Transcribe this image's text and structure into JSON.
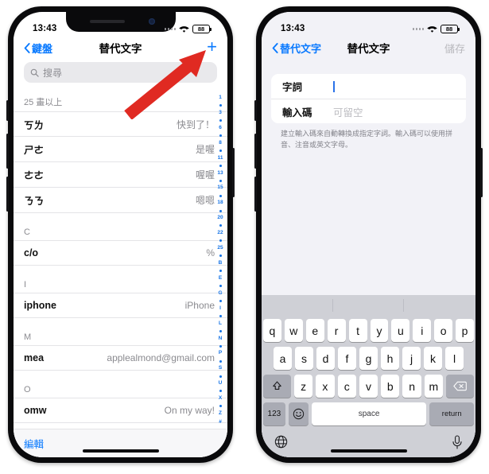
{
  "status_bar": {
    "time": "13:43",
    "battery": "88",
    "wifi_icon": "wifi-icon",
    "signal_icon": "signal-dots-icon"
  },
  "left_phone": {
    "nav": {
      "back_label": "鍵盤",
      "title": "替代文字",
      "add_label": "+"
    },
    "search": {
      "placeholder": "搜尋",
      "icon": "search-icon"
    },
    "sections": [
      {
        "header": "25 畫以上",
        "rows": [
          {
            "shortcut": "ㄎㄌ",
            "phrase": "快到了！"
          },
          {
            "shortcut": "ㄕㄜ",
            "phrase": "是喔"
          },
          {
            "shortcut": "ㄜㄜ",
            "phrase": "喔喔"
          },
          {
            "shortcut": "ㄋㄋ",
            "phrase": "嗯嗯"
          }
        ]
      },
      {
        "header": "C",
        "rows": [
          {
            "shortcut": "c/o",
            "phrase": "%"
          }
        ]
      },
      {
        "header": "I",
        "rows": [
          {
            "shortcut": "iphone",
            "phrase": "iPhone"
          }
        ]
      },
      {
        "header": "M",
        "rows": [
          {
            "shortcut": "mea",
            "phrase": "applealmond@gmail.com"
          }
        ]
      },
      {
        "header": "O",
        "rows": [
          {
            "shortcut": "omw",
            "phrase": "On my way!"
          }
        ]
      }
    ],
    "section_index": [
      "1",
      "•",
      "3",
      "•",
      "6",
      "•",
      "8",
      "•",
      "11",
      "•",
      "13",
      "•",
      "15",
      "•",
      "18",
      "•",
      "20",
      "•",
      "22",
      "•",
      "25",
      "•",
      "B",
      "•",
      "E",
      "•",
      "G",
      "•",
      "I",
      "•",
      "L",
      "•",
      "N",
      "•",
      "P",
      "•",
      "S",
      "•",
      "U",
      "•",
      "X",
      "•",
      "Z",
      "#"
    ],
    "edit_label": "編輯"
  },
  "right_phone": {
    "nav": {
      "back_label": "替代文字",
      "title": "替代文字",
      "save_label": "儲存"
    },
    "form": {
      "phrase_label": "字詞",
      "phrase_value": "",
      "shortcut_label": "輸入碼",
      "shortcut_placeholder": "可留空",
      "footer": "建立輸入碼來自動轉換成指定字詞。輸入碼可以使用拼音、注音或英文字母。"
    },
    "keyboard": {
      "row1": [
        "q",
        "w",
        "e",
        "r",
        "t",
        "y",
        "u",
        "i",
        "o",
        "p"
      ],
      "row2": [
        "a",
        "s",
        "d",
        "f",
        "g",
        "h",
        "j",
        "k",
        "l"
      ],
      "row3": [
        "z",
        "x",
        "c",
        "v",
        "b",
        "n",
        "m"
      ],
      "shift_icon": "shift-icon",
      "backspace_icon": "backspace-icon",
      "numeric_label": "123",
      "emoji_icon": "emoji-icon",
      "space_label": "space",
      "return_label": "return",
      "globe_icon": "globe-icon",
      "mic_icon": "microphone-icon"
    }
  },
  "annotation": {
    "arrow_color": "#e02a22",
    "arrow_name": "red-arrow-pointing-to-add-button"
  },
  "colors": {
    "accent_blue": "#0a7aff",
    "index_blue": "#1473e6",
    "grouped_bg": "#f2f2f7",
    "keyboard_bg": "#cfd0d6"
  }
}
